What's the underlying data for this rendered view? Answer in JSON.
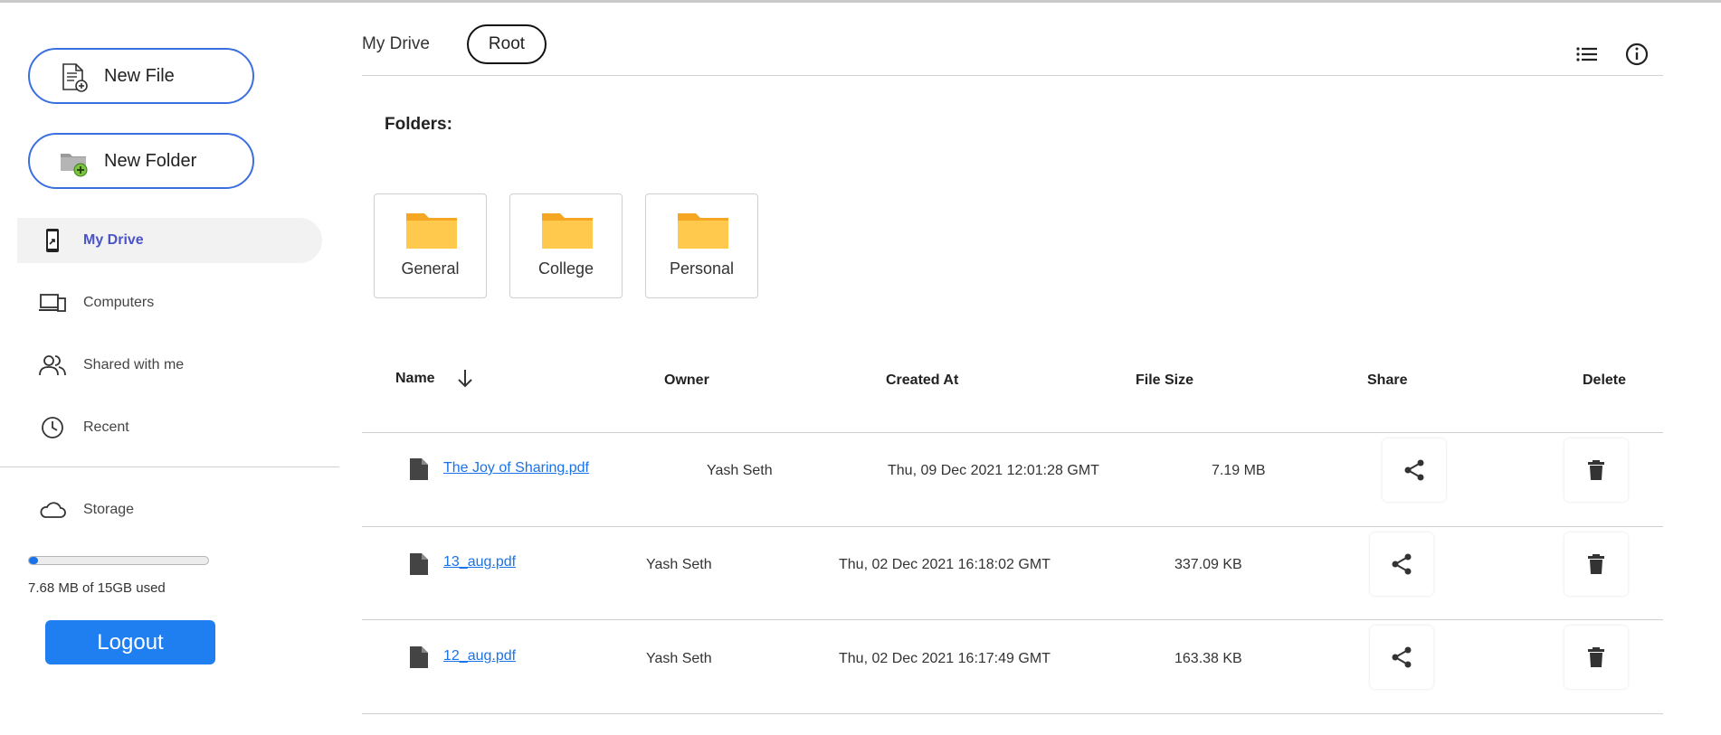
{
  "sidebar": {
    "new_file_label": "New File",
    "new_folder_label": "New Folder",
    "nav": {
      "my_drive": "My Drive",
      "computers": "Computers",
      "shared": "Shared with me",
      "recent": "Recent",
      "storage": "Storage"
    },
    "storage_used_fraction": 0.0005,
    "storage_text": "7.68 MB of 15GB used",
    "logout_label": "Logout",
    "accent_color": "#3b6fe0",
    "active_color": "#4a53c8"
  },
  "header": {
    "breadcrumb": [
      "My Drive",
      "Root"
    ],
    "icons": [
      "list-view-icon",
      "info-icon"
    ]
  },
  "folders": {
    "title": "Folders:",
    "items": [
      {
        "name": "General"
      },
      {
        "name": "College"
      },
      {
        "name": "Personal"
      }
    ]
  },
  "table": {
    "columns": [
      "Name",
      "Owner",
      "Created At",
      "File Size",
      "Share",
      "Delete"
    ],
    "rows": [
      {
        "name": "The Joy of Sharing.pdf",
        "owner": "Yash Seth",
        "created": "Thu, 09 Dec 2021 12:01:28 GMT",
        "size": "7.19 MB"
      },
      {
        "name": "13_aug.pdf",
        "owner": "Yash Seth",
        "created": "Thu, 02 Dec 2021 16:18:02 GMT",
        "size": "337.09 KB"
      },
      {
        "name": "12_aug.pdf",
        "owner": "Yash Seth",
        "created": "Thu, 02 Dec 2021 16:17:49 GMT",
        "size": "163.38 KB"
      }
    ]
  }
}
